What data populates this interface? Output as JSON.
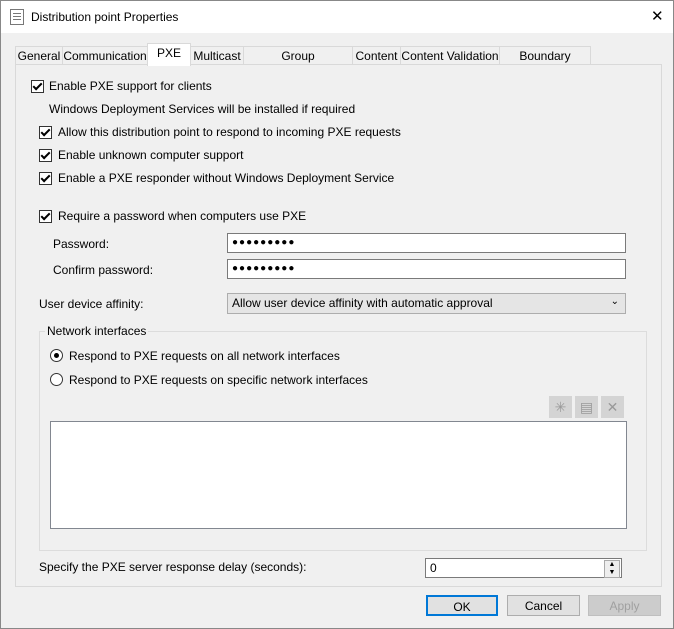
{
  "window": {
    "title": "Distribution point Properties",
    "close": "✕"
  },
  "tabs": [
    {
      "label": "General"
    },
    {
      "label": "Communication"
    },
    {
      "label": "PXE"
    },
    {
      "label": "Multicast"
    },
    {
      "label": "Group Relationships"
    },
    {
      "label": "Content"
    },
    {
      "label": "Content Validation"
    },
    {
      "label": "Boundary Groups"
    }
  ],
  "selected_tab": "PXE",
  "pxe": {
    "enable_pxe": {
      "label": "Enable PXE support for clients",
      "checked": true
    },
    "wds_note": "Windows Deployment Services will be installed if required",
    "allow_respond": {
      "label": "Allow this distribution point to respond to incoming PXE requests",
      "checked": true
    },
    "unknown_support": {
      "label": "Enable unknown computer support",
      "checked": true
    },
    "pxe_responder": {
      "label": "Enable a PXE responder without Windows Deployment Service",
      "checked": true
    },
    "require_password": {
      "label": "Require a password when computers use PXE",
      "checked": true
    },
    "password_label": "Password:",
    "password_value": "●●●●●●●●●",
    "confirm_label": "Confirm password:",
    "confirm_value": "●●●●●●●●●",
    "affinity_label": "User device affinity:",
    "affinity_value": "Allow user device affinity with automatic approval",
    "network_group": "Network interfaces",
    "radio_all": {
      "label": "Respond to PXE requests on all network interfaces",
      "selected": true
    },
    "radio_specific": {
      "label": "Respond to PXE requests on specific network interfaces",
      "selected": false
    },
    "delay_label": "Specify the PXE server response delay (seconds):",
    "delay_value": "0"
  },
  "buttons": {
    "ok": "OK",
    "cancel": "Cancel",
    "apply": "Apply"
  }
}
